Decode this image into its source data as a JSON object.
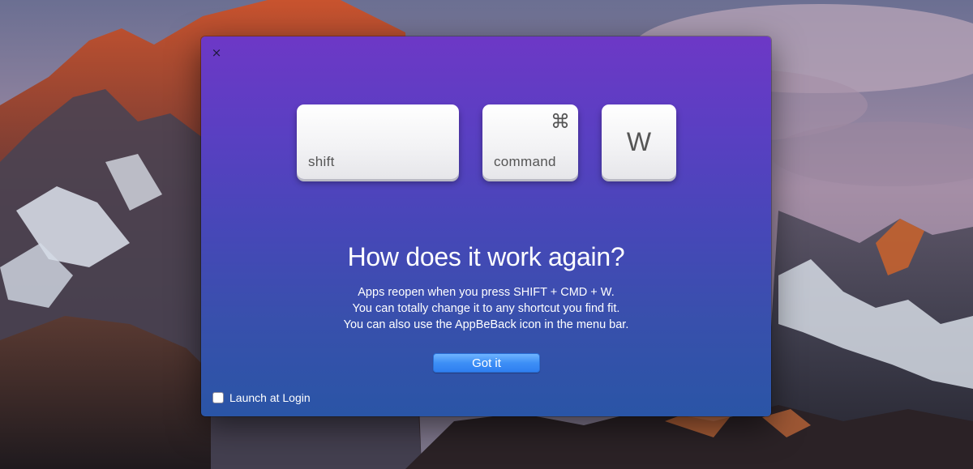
{
  "window": {
    "close_icon": "close-icon",
    "close_glyph": "×"
  },
  "keys": {
    "shift": {
      "label": "shift"
    },
    "command": {
      "label": "command",
      "symbol": "⌘"
    },
    "w": {
      "char": "W"
    }
  },
  "content": {
    "headline": "How does it work again?",
    "lines": [
      "Apps reopen when you press SHIFT + CMD + W.",
      "You can totally change it to any shortcut you find fit.",
      "You can also use the AppBeBack icon in the menu bar."
    ]
  },
  "actions": {
    "got_it_label": "Got it"
  },
  "launch_at_login": {
    "label": "Launch at Login",
    "checked": false
  },
  "colors": {
    "window_gradient_top": "#6d38c6",
    "window_gradient_bottom": "#2a55a6",
    "button_blue": "#3d8ff6"
  }
}
